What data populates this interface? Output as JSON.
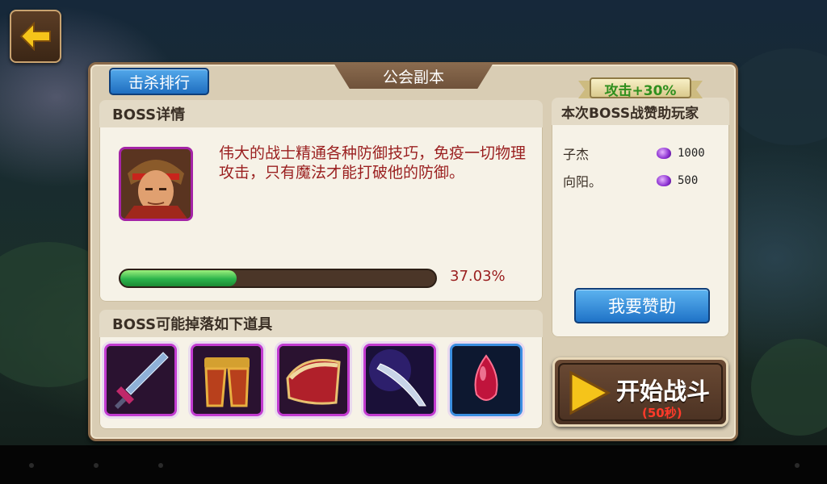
{
  "header": {
    "title": "公会副本",
    "rank_button": "击杀排行"
  },
  "boss": {
    "section_title": "BOSS详情",
    "description": "伟大的战士精通各种防御技巧，免疫一切物理攻击，只有魔法才能打破他的防御。",
    "hp_progress_fraction": 0.3703,
    "hp_progress_text": "37.03%"
  },
  "drops": {
    "section_title": "BOSS可能掉落如下道具",
    "items": [
      {
        "icon": "sword-icon",
        "frame_color": "#c23bd0"
      },
      {
        "icon": "armor-pants-icon",
        "frame_color": "#c23bd0"
      },
      {
        "icon": "shoulder-armor-icon",
        "frame_color": "#c23bd0"
      },
      {
        "icon": "blade-icon",
        "frame_color": "#c23bd0"
      },
      {
        "icon": "red-gem-icon",
        "frame_color": "#3a8ee0"
      }
    ]
  },
  "sponsor": {
    "buff_ribbon": "攻击+30%",
    "section_title": "本次BOSS战赞助玩家",
    "players": [
      {
        "name": "子杰",
        "amount": "1000"
      },
      {
        "name": "向阳。",
        "amount": "500"
      }
    ],
    "sponsor_button": "我要赞助"
  },
  "battle": {
    "start_label": "开始战斗",
    "timer_label": "(50秒)"
  }
}
